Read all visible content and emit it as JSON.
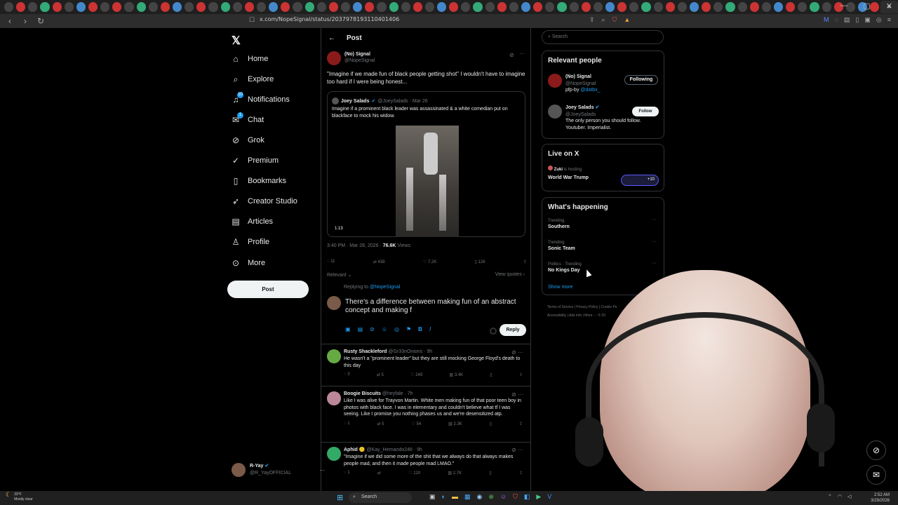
{
  "browser": {
    "url": "x.com/NopeSignal/status/2037978193110401406",
    "active_tab_close": "×",
    "window_controls": [
      "—",
      "▢",
      "✕"
    ]
  },
  "nav": {
    "items": [
      {
        "label": "Home",
        "icon": "home-icon"
      },
      {
        "label": "Explore",
        "icon": "search-icon"
      },
      {
        "label": "Notifications",
        "icon": "bell-icon",
        "badge": "10"
      },
      {
        "label": "Chat",
        "icon": "mail-icon",
        "badge": "1"
      },
      {
        "label": "Grok",
        "icon": "grok-icon"
      },
      {
        "label": "Premium",
        "icon": "premium-icon"
      },
      {
        "label": "Bookmarks",
        "icon": "bookmark-icon"
      },
      {
        "label": "Creator Studio",
        "icon": "rocket-icon"
      },
      {
        "label": "Articles",
        "icon": "article-icon"
      },
      {
        "label": "Profile",
        "icon": "person-icon"
      },
      {
        "label": "More",
        "icon": "more-circle-icon"
      }
    ],
    "post_label": "Post",
    "me": {
      "name": "R-Yay",
      "handle": "@R_YayOFFICIAL"
    }
  },
  "main": {
    "header": "Post",
    "author": {
      "name": "(No) Signal",
      "handle": "@NopeSignal"
    },
    "text": "\"Imagine if we made fun of black people getting shot\" I wouldn't have to imagine too hard if I were being honest...",
    "quote": {
      "name": "Joey Salads",
      "handle_time": "@JoeySalads · Mar 26",
      "text": "Imagine if a prominent black leader was assassinated & a white comedian put on blackface to mock his widow.",
      "duration": "1:13"
    },
    "timestamp": "3:40 PM · Mar 28, 2026 · ",
    "views_count": "76.6K",
    "views_label": " Views",
    "actions": {
      "replies": "11",
      "reposts": "438",
      "likes": "7.2K",
      "bookmarks": "126"
    },
    "sort_label": "Relevant",
    "view_quotes": "View quotes",
    "replying_to": "Replying to ",
    "replying_handle": "@NopeSignal",
    "compose_text": "There's a difference between making fun of an abstract concept and making f",
    "reply_label": "Reply",
    "replies": [
      {
        "name": "Rusty Shackleford",
        "handle": "@Gr33nOnions · 9h",
        "text": "He wasn't a \"prominent leader\" but they are still mocking George Floyd's death to this day",
        "r": "3",
        "rt": "5",
        "l": "249",
        "v": "3.4K"
      },
      {
        "name": "Boogie Biscuits",
        "handle": "@heyfale · 7h",
        "text": "Like I was alive for Trayvon Martin. White men making fun of that poor teen boy in photos with black face. I was in elementary and couldn't believe what tf I was seeing. Like I promise you nothing phases us and we're desensitized atp.",
        "r": "1",
        "rt": "5",
        "l": "54",
        "v": "2.3K"
      },
      {
        "name": "Aphid 🙃",
        "handle": "@Kay_Hernando246 · 9h",
        "text": "\"Imagine if we did some more of the shit that we always do that always makes people mad, and then it made people mad LMAO.\"",
        "r": "1",
        "rt": "",
        "l": "120",
        "v": "2.7K"
      }
    ]
  },
  "right": {
    "search_placeholder": "Search",
    "relevant_title": "Relevant people",
    "people": [
      {
        "name": "(No) Signal",
        "handle": "@NopeSignal",
        "bio": "pfp-by ",
        "bio_link": "@datbx_",
        "button": "Following"
      },
      {
        "name": "Joey Salads",
        "handle": "@JoeySalads",
        "bio": "The only person you should follow. Youtuber. Imperialist.",
        "button": "Follow"
      }
    ],
    "live_title": "Live on X",
    "live_host": "Zuki",
    "live_host_suffix": " is hosting",
    "live_show": "World War Trump",
    "live_count": "+10",
    "happening_title": "What's happening",
    "trends": [
      {
        "context": "Trending",
        "name": "Southern"
      },
      {
        "context": "Trending",
        "name": "Sonic Team"
      },
      {
        "context": "Politics · Trending",
        "name": "No Kings Day"
      }
    ],
    "show_more": "Show more",
    "footer_line1": "Terms of Service  |  Privacy Policy  |  Cookie Po",
    "footer_line2": "Accessibility  |  Ads info  |  More ···  © 20"
  },
  "taskbar": {
    "weather_temp": "33°F",
    "weather_desc": "Mostly clear",
    "search_label": "Search",
    "time": "2:52 AM",
    "date": "3/29/2026"
  },
  "colors": {
    "accent": "#1d9bf0",
    "background": "#000000",
    "border": "#2f3336"
  }
}
